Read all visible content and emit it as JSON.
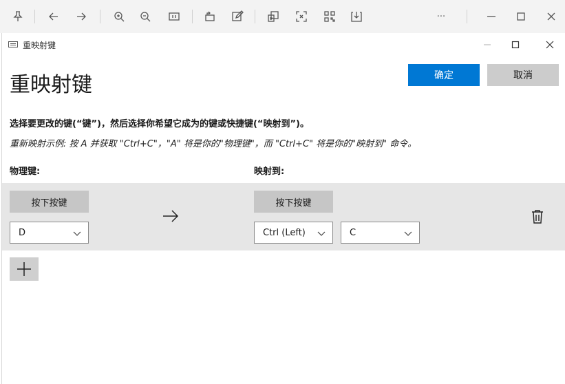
{
  "viewer_toolbar": {
    "icons": [
      "pin-icon",
      "back-icon",
      "forward-icon",
      "zoom-in-icon",
      "zoom-out-icon",
      "fit-page-icon",
      "rotate-icon",
      "edit-icon",
      "text-recognition-icon",
      "crop-icon",
      "qr-code-icon",
      "download-icon",
      "more-icon",
      "minimize-icon",
      "maximize-icon",
      "close-icon"
    ],
    "more_label": "···"
  },
  "window": {
    "title": "重映射键"
  },
  "page": {
    "title": "重映射键",
    "ok_label": "确定",
    "cancel_label": "取消",
    "instruction": "选择要更改的键(“键”)，然后选择你希望它成为的键或快捷键(“映射到”)。",
    "example": "重新映射示例: 按 A 并获取 \"Ctrl+C\"，\"A\" 将是你的\"物理键\"，而 \"Ctrl+C\" 将是你的\"映射到\" 命令。",
    "physical_key_header": "物理键:",
    "mapped_to_header": "映射到:"
  },
  "mapping": {
    "press_key_label": "按下按键",
    "physical_key_value": "D",
    "mapped_press_key_label": "按下按键",
    "mapped_modifier_value": "Ctrl (Left)",
    "mapped_key_value": "C"
  }
}
